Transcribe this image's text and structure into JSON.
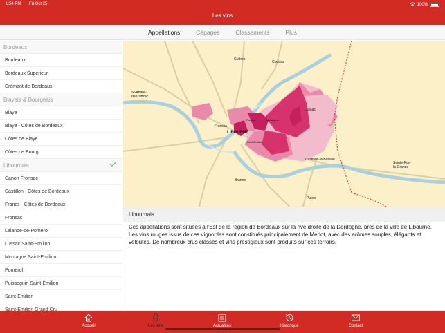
{
  "status_bar": {
    "time": "1:54 PM",
    "date": "Fri Oct 25",
    "battery": "100%"
  },
  "header": {
    "title": "Les vins"
  },
  "tabs": [
    {
      "label": "Appellations",
      "active": true
    },
    {
      "label": "Cépages",
      "active": false
    },
    {
      "label": "Classements",
      "active": false
    },
    {
      "label": "Plus",
      "active": false
    }
  ],
  "sidebar": {
    "items": [
      {
        "label": "Bordeaux",
        "type": "section"
      },
      {
        "label": "Bordeaux",
        "type": "item"
      },
      {
        "label": "Bordeaux Supérieur",
        "type": "item"
      },
      {
        "label": "Crémant de Bordeaux",
        "type": "item"
      },
      {
        "label": "Blayais & Bourgeais",
        "type": "section"
      },
      {
        "label": "Blaye",
        "type": "item"
      },
      {
        "label": "Blaye - Côtes de Bordeaux",
        "type": "item"
      },
      {
        "label": "Côtes de Blaye",
        "type": "item"
      },
      {
        "label": "Côtes de Bourg",
        "type": "item"
      },
      {
        "label": "Libournais",
        "type": "section",
        "selected": true
      },
      {
        "label": "Canon Fronsac",
        "type": "item"
      },
      {
        "label": "Castillon - Côtes de Bordeaux",
        "type": "item"
      },
      {
        "label": "Francs - Côtes de Bordeaux",
        "type": "item"
      },
      {
        "label": "Fronsac",
        "type": "item"
      },
      {
        "label": "Lalande-de-Pomerol",
        "type": "item"
      },
      {
        "label": "Lussac Saint-Emilion",
        "type": "item"
      },
      {
        "label": "Montagne Saint-Emilion",
        "type": "item"
      },
      {
        "label": "Pomerol",
        "type": "item"
      },
      {
        "label": "Puisseguin Saint-Emilion",
        "type": "item"
      },
      {
        "label": "Saint-Emilion",
        "type": "item"
      },
      {
        "label": "Saint-Emilion Grand Cru",
        "type": "item"
      }
    ]
  },
  "map": {
    "labels": {
      "guitres": "Guîtres",
      "coutras": "Coutras",
      "st_andre": "St-André-",
      "cubzac": "de-Cubzac",
      "lussac": "Lussac",
      "montagne": "Montagne",
      "fronsac": "Fronsac",
      "libourne": "LIBOURNE",
      "pomerol": "Pomerol",
      "saint_emilion": "Saint-Emilion",
      "castillon": "Castillon-la-Bataille",
      "sainte_foy_1": "Sainte-Foy-",
      "sainte_foy_2": "la-Grande",
      "branne": "Branne",
      "pujols": "Pujols"
    },
    "colors": {
      "background": "#fbf0c8",
      "road": "#d6cfa6",
      "river": "#a7cfe0",
      "dark_pink": "#d6336c",
      "mid_pink": "#e98aaa",
      "light_pink": "#f3bccd",
      "magenta": "#c51f5d"
    }
  },
  "detail": {
    "title": "Libournais",
    "description": "Ces appellations sont situées à l'Est de la région de Bordeaux sur la rive droite de la Dordogne, près de la ville de Libourne. Les vins rouges issus de ces vignobles sont constitués principalement de Merlot, avec des arômes souples, élégants et veloutés. De nombreux crus classés et vins prestigieux sont produits sur ces terroirs."
  },
  "tabbar": [
    {
      "label": "Accueil",
      "icon": "home-icon"
    },
    {
      "label": "Les vins",
      "icon": "wine-icon"
    },
    {
      "label": "Actualités",
      "icon": "newspaper-icon"
    },
    {
      "label": "Historique",
      "icon": "history-icon"
    },
    {
      "label": "Contact",
      "icon": "mail-icon"
    }
  ]
}
